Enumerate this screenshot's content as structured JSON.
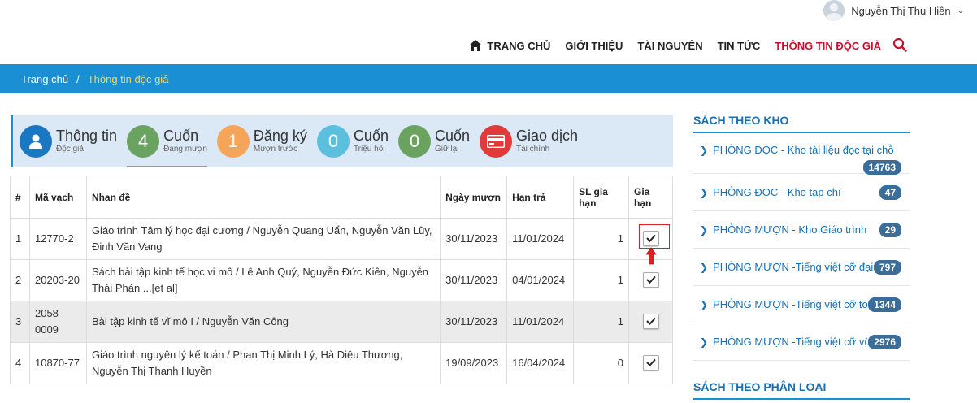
{
  "user": {
    "name": "Nguyễn Thị Thu Hiền"
  },
  "nav": {
    "items": [
      {
        "label": "TRANG CHỦ",
        "icon": "home-icon"
      },
      {
        "label": "GIỚI THIỆU"
      },
      {
        "label": "TÀI NGUYÊN"
      },
      {
        "label": "TIN TỨC"
      },
      {
        "label": "THÔNG TIN ĐỘC GIẢ",
        "active": true
      }
    ],
    "search_icon": "search-icon",
    "active_color": "#c8102e"
  },
  "breadcrumb": {
    "home": "Trang chủ",
    "separator": "/",
    "current": "Thông tin độc giả"
  },
  "summary": {
    "info": {
      "big": "Thông tin",
      "small": "Độc giả",
      "color": "#1a78c2"
    },
    "borrowing": {
      "count": "4",
      "big": "Cuốn",
      "small": "Đang mượn",
      "color": "#6aa35f"
    },
    "reserved": {
      "count": "1",
      "big": "Đăng ký",
      "small": "Mượn trước",
      "color": "#f5a55a"
    },
    "recalled": {
      "count": "0",
      "big": "Cuốn",
      "small": "Triệu hồi",
      "color": "#5bc0de"
    },
    "held": {
      "count": "0",
      "big": "Cuốn",
      "small": "Giữ lại",
      "color": "#6aa35f"
    },
    "transactions": {
      "big": "Giao dịch",
      "small": "Tài chính",
      "color": "#e03a3a"
    }
  },
  "table": {
    "headers": {
      "num": "#",
      "barcode": "Mã vạch",
      "title": "Nhan đề",
      "borrow_date": "Ngày mượn",
      "due_date": "Hạn trả",
      "renew_count": "SL gia hạn",
      "renew": "Gia hạn"
    },
    "rows": [
      {
        "num": "1",
        "barcode": "12770-2",
        "title": "Giáo trình Tâm lý học đại cương / Nguyễn Quang Uẩn, Nguyễn Văn Lũy, Đinh Văn Vang",
        "borrow_date": "30/11/2023",
        "due_date": "11/01/2024",
        "renew_count": "1"
      },
      {
        "num": "2",
        "barcode": "20203-20",
        "title": "Sách bài tập kinh tế học vi mô / Lê Anh Quý, Nguyễn Đức Kiên, Nguyễn Thái Phán ...[et al]",
        "borrow_date": "30/11/2023",
        "due_date": "04/01/2024",
        "renew_count": "1"
      },
      {
        "num": "3",
        "barcode": "2058-0009",
        "title": "Bài tập kinh tế vĩ mô I / Nguyễn Văn Công",
        "borrow_date": "30/11/2023",
        "due_date": "11/01/2024",
        "renew_count": "1"
      },
      {
        "num": "4",
        "barcode": "10870-77",
        "title": "Giáo trình nguyên lý kế toán / Phan Thị Minh Lý, Hà Diệu Thương, Nguyễn Thị Thanh Huyền",
        "borrow_date": "19/09/2023",
        "due_date": "16/04/2024",
        "renew_count": "0"
      }
    ]
  },
  "sidebar": {
    "kho_title": "SÁCH THEO KHO",
    "kho_items": [
      {
        "label": "PHÒNG ĐỌC - Kho tài liệu đọc tại chỗ",
        "count": "14763"
      },
      {
        "label": "PHÒNG ĐỌC - Kho tạp chí",
        "count": "47"
      },
      {
        "label": "PHÒNG MƯỢN - Kho Giáo trình",
        "count": "29"
      },
      {
        "label": "PHÒNG MƯỢN -Tiếng việt cỡ đại",
        "count": "797"
      },
      {
        "label": "PHÒNG MƯỢN -Tiếng việt cỡ to",
        "count": "1344"
      },
      {
        "label": "PHÒNG MƯỢN -Tiếng việt cỡ vừa",
        "count": "2976"
      }
    ],
    "phanloai_title": "SÁCH THEO PHÂN LOẠI"
  }
}
